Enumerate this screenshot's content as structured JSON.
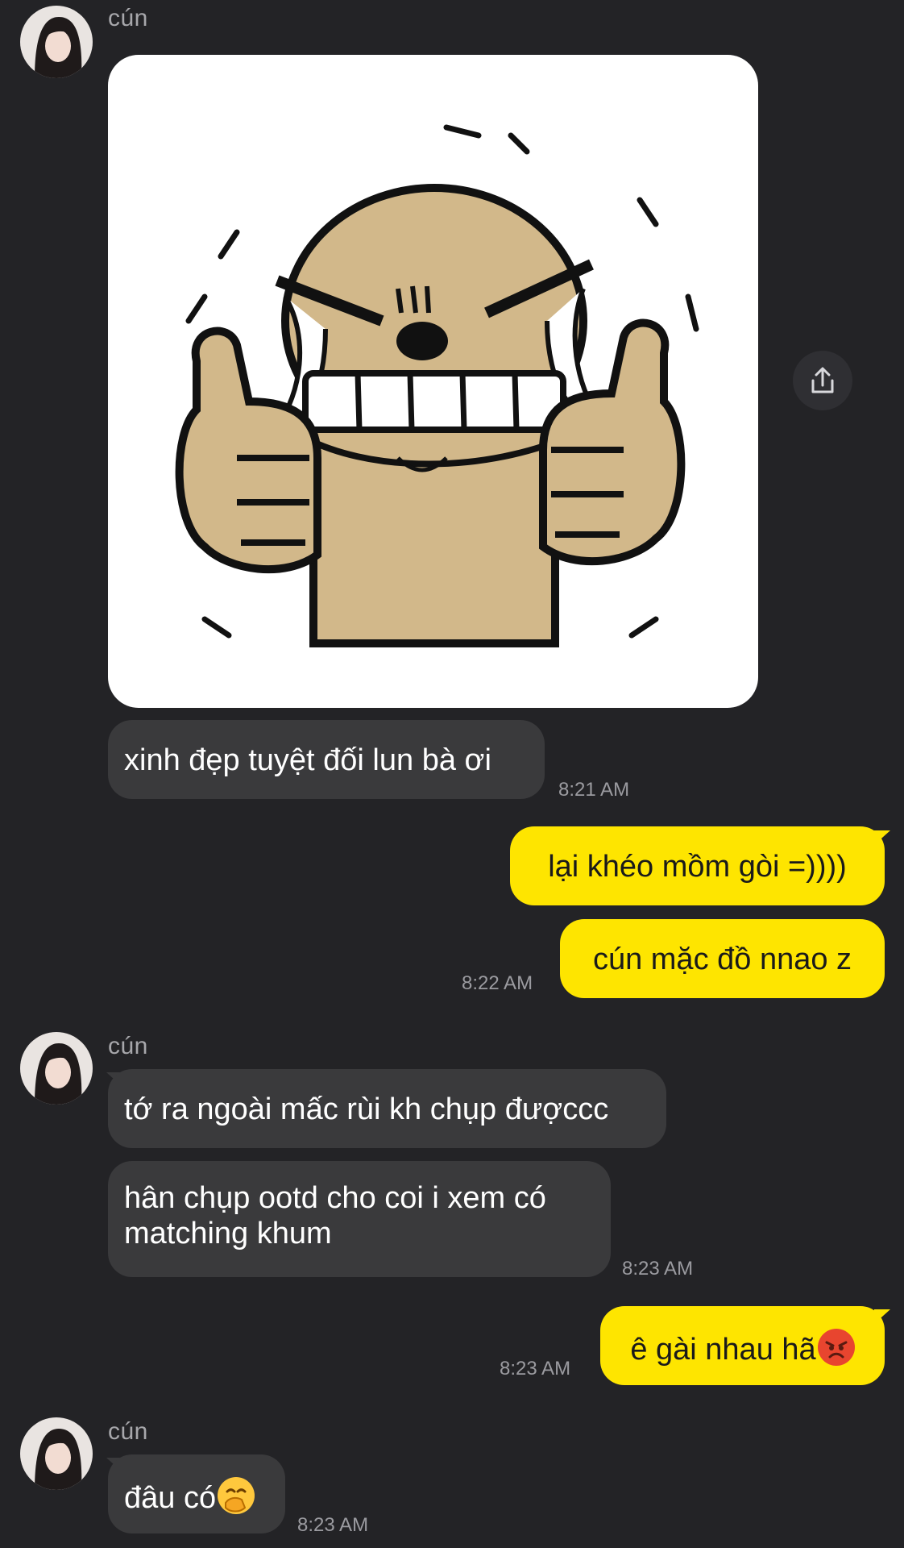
{
  "contact": {
    "name": "cún"
  },
  "colors": {
    "background": "#232326",
    "incoming_bubble": "#3a3a3c",
    "outgoing_bubble": "#fee500",
    "timestamp": "#9b9ba0"
  },
  "messages": [
    {
      "id": "m1",
      "type": "sticker",
      "direction": "in",
      "sender": "cún",
      "sticker": "crying-thumbs-up-sticker"
    },
    {
      "id": "m2",
      "type": "text",
      "direction": "in",
      "text": "xinh đẹp tuyệt đối lun bà ơi",
      "time": "8:21 AM"
    },
    {
      "id": "m3",
      "type": "text",
      "direction": "out",
      "text": "lại khéo mồm gòi =))))"
    },
    {
      "id": "m4",
      "type": "text",
      "direction": "out",
      "text": "cún mặc đồ nnao z",
      "time": "8:22 AM"
    },
    {
      "id": "m5",
      "type": "text",
      "direction": "in",
      "sender": "cún",
      "text": "tớ ra ngoài mấc rùi kh chụp đượccc"
    },
    {
      "id": "m6",
      "type": "text",
      "direction": "in",
      "text_line1": "hân chụp ootd cho coi i xem có",
      "text_line2": "matching khum",
      "time": "8:23 AM"
    },
    {
      "id": "m7",
      "type": "text",
      "direction": "out",
      "text": "ê gài nhau hã",
      "emoji": "angry-face-emoji",
      "time": "8:23 AM"
    },
    {
      "id": "m8",
      "type": "text",
      "direction": "in",
      "sender": "cún",
      "text": "đâu có",
      "emoji": "face-with-hand-over-mouth-emoji",
      "time": "8:23 AM"
    }
  ],
  "icons": {
    "share": "share-upload-icon"
  }
}
